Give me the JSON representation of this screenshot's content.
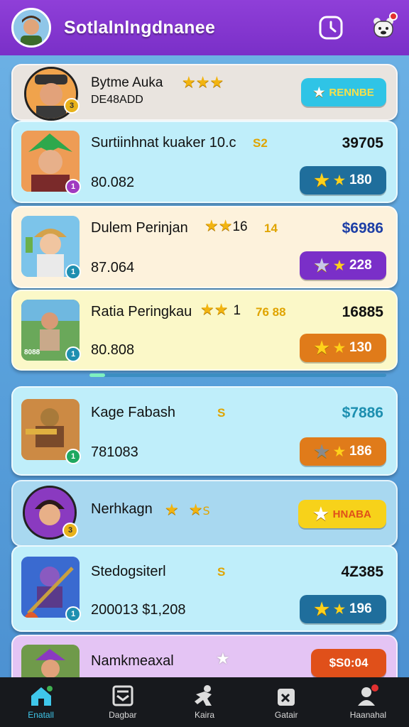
{
  "header": {
    "title": "Sotlalnlngdnanee",
    "icons": [
      "avatar",
      "clock-icon",
      "bear-icon"
    ]
  },
  "featured_top": {
    "name": "Bytme Auka",
    "sub": "DE48ADD",
    "stars": "★★★",
    "button": "RENNBE"
  },
  "items": [
    {
      "name": "Surtiinhnat kuaker 10.c",
      "tag": "S2",
      "sub": "80.082",
      "price": "39705",
      "price_color": "#111111",
      "button": "180",
      "button_color": "#1f6e9c"
    },
    {
      "name": "Dulem Perinjan",
      "stars_text": "16",
      "tag": "14",
      "sub": "87.064",
      "price": "$6986",
      "price_color": "#1d3fa6",
      "button": "228",
      "button_color": "#7a2fc8"
    },
    {
      "name": "Ratia Peringkau",
      "stars_text": "1",
      "tag": "76 88",
      "sub": "80.808",
      "price": "16885",
      "price_color": "#111111",
      "button": "130",
      "button_color": "#e07b1a",
      "thumb_text": "8088"
    },
    {
      "name": "Kage Fabash",
      "tag": "S",
      "sub": "781083",
      "price": "$7886",
      "price_color": "#1c8fb0",
      "button": "186",
      "button_color": "#e07b1a"
    },
    {
      "name": "Nerhkagn",
      "tag": "",
      "sub": "",
      "price": "",
      "button": "HNABA",
      "button_color": "#f7d21a"
    },
    {
      "name": "Stedogsiterl",
      "tag": "S",
      "sub": "200013 $1,208",
      "price": "4Z385",
      "price_color": "#111111",
      "button": "196",
      "button_color": "#1f6e9c"
    },
    {
      "name": "Namkmeaxal",
      "tag": "",
      "sub": "",
      "price": "",
      "button": "$S0:04",
      "button_color": "#e0501a"
    }
  ],
  "nav": [
    {
      "label": "Enatall",
      "icon": "home-icon"
    },
    {
      "label": "Dagbar",
      "icon": "inbox-icon"
    },
    {
      "label": "Kaira",
      "icon": "fighter-icon"
    },
    {
      "label": "Gatair",
      "icon": "bag-icon"
    },
    {
      "label": "Haanahal",
      "icon": "profile-icon"
    }
  ],
  "colors": {
    "topbar": "#7a2fc8",
    "active_nav": "#3fc7ea",
    "star": "#f2b410"
  }
}
